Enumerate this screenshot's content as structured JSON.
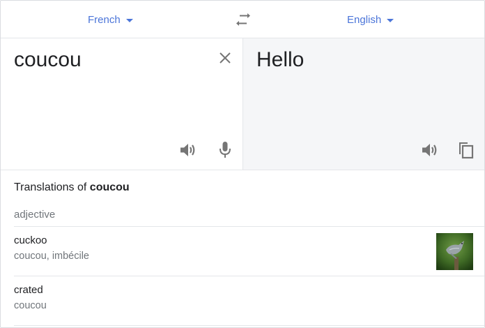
{
  "languages": {
    "source": "French",
    "target": "English"
  },
  "source": {
    "text": "coucou"
  },
  "target": {
    "text": "Hello"
  },
  "translations": {
    "heading_prefix": "Translations of ",
    "heading_word": "coucou",
    "part_of_speech": "adjective",
    "entries": [
      {
        "word": "cuckoo",
        "synonyms": "coucou, imbécile",
        "has_image": true
      },
      {
        "word": "crated",
        "synonyms": "coucou",
        "has_image": false
      }
    ]
  },
  "icons": {
    "caret": "caret-down-icon",
    "swap": "swap-arrows-icon",
    "clear": "close-icon",
    "speaker": "speaker-icon",
    "mic": "microphone-icon",
    "copy": "copy-icon"
  },
  "colors": {
    "accent": "#4b75d9",
    "icon": "#757575",
    "target_bg": "#f5f6f8",
    "divider": "#e4e6e9"
  }
}
